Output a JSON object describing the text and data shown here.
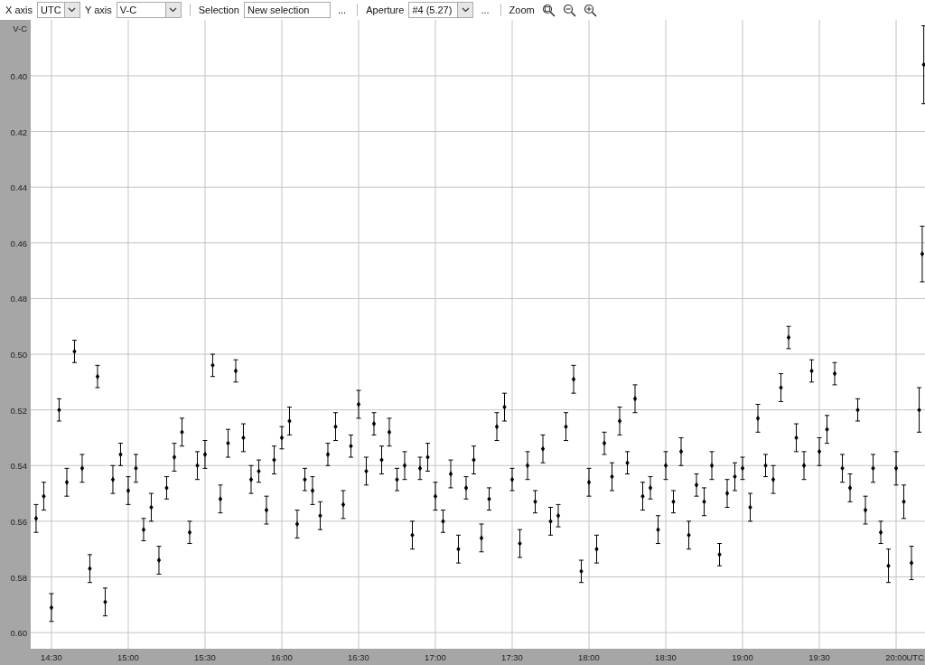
{
  "toolbar": {
    "x_axis": {
      "label": "X axis",
      "value": "UTC"
    },
    "y_axis": {
      "label": "Y axis",
      "value": "V-C"
    },
    "selection": {
      "label": "Selection",
      "value": "New selection",
      "more": "..."
    },
    "aperture": {
      "label": "Aperture",
      "value": "#4 (5.27)",
      "more": "..."
    },
    "zoom": {
      "label": "Zoom"
    }
  },
  "chart": {
    "chart_data": {
      "type": "scatter",
      "xlabel": "UTC",
      "ylabel": "V-C",
      "xlim": [
        14.365,
        20.188
      ],
      "ylim": [
        0.6058,
        0.3799
      ],
      "grid": true,
      "xticks": [
        {
          "value": 14.5,
          "label": "14:30"
        },
        {
          "value": 15,
          "label": "15:00"
        },
        {
          "value": 15.5,
          "label": "15:30"
        },
        {
          "value": 16,
          "label": "16:00"
        },
        {
          "value": 16.5,
          "label": "16:30"
        },
        {
          "value": 17,
          "label": "17:00"
        },
        {
          "value": 17.5,
          "label": "17:30"
        },
        {
          "value": 18,
          "label": "18:00"
        },
        {
          "value": 18.5,
          "label": "18:30"
        },
        {
          "value": 19,
          "label": "19:00"
        },
        {
          "value": 19.5,
          "label": "19:30"
        },
        {
          "value": 20,
          "label": "20:00"
        }
      ],
      "yticks": [
        {
          "value": 0.4,
          "label": "0.40"
        },
        {
          "value": 0.42,
          "label": "0.42"
        },
        {
          "value": 0.44,
          "label": "0.44"
        },
        {
          "value": 0.46,
          "label": "0.46"
        },
        {
          "value": 0.48,
          "label": "0.48"
        },
        {
          "value": 0.5,
          "label": "0.50"
        },
        {
          "value": 0.52,
          "label": "0.52"
        },
        {
          "value": 0.54,
          "label": "0.54"
        },
        {
          "value": 0.56,
          "label": "0.56"
        },
        {
          "value": 0.58,
          "label": "0.58"
        },
        {
          "value": 0.6,
          "label": "0.60"
        }
      ],
      "x": [
        14.4,
        14.45,
        14.5,
        14.55,
        14.6,
        14.65,
        14.7,
        14.75,
        14.8,
        14.85,
        14.9,
        14.95,
        15.0,
        15.05,
        15.1,
        15.15,
        15.2,
        15.25,
        15.3,
        15.35,
        15.4,
        15.45,
        15.5,
        15.55,
        15.6,
        15.65,
        15.7,
        15.75,
        15.8,
        15.85,
        15.9,
        15.95,
        16.0,
        16.05,
        16.1,
        16.15,
        16.2,
        16.25,
        16.3,
        16.35,
        16.4,
        16.45,
        16.5,
        16.55,
        16.6,
        16.65,
        16.7,
        16.75,
        16.8,
        16.85,
        16.9,
        16.95,
        17.0,
        17.05,
        17.1,
        17.15,
        17.2,
        17.25,
        17.3,
        17.35,
        17.4,
        17.45,
        17.5,
        17.55,
        17.6,
        17.65,
        17.7,
        17.75,
        17.8,
        17.85,
        17.9,
        17.95,
        18.0,
        18.05,
        18.1,
        18.15,
        18.2,
        18.25,
        18.3,
        18.35,
        18.4,
        18.45,
        18.5,
        18.55,
        18.6,
        18.65,
        18.7,
        18.75,
        18.8,
        18.85,
        18.9,
        18.95,
        19.0,
        19.05,
        19.1,
        19.15,
        19.2,
        19.25,
        19.3,
        19.35,
        19.4,
        19.45,
        19.5,
        19.55,
        19.6,
        19.65,
        19.7,
        19.75,
        19.8,
        19.85,
        19.9,
        19.95,
        20.0,
        20.05,
        20.1,
        20.15,
        20.17,
        20.18
      ],
      "series": [
        {
          "color": "#000000",
          "values": [
            0.559,
            0.551,
            0.591,
            0.52,
            0.546,
            0.499,
            0.541,
            0.577,
            0.508,
            0.589,
            0.545,
            0.536,
            0.549,
            0.541,
            0.563,
            0.555,
            0.574,
            0.548,
            0.537,
            0.528,
            0.564,
            0.54,
            0.536,
            0.504,
            0.552,
            0.532,
            0.506,
            0.53,
            0.545,
            0.542,
            0.556,
            0.538,
            0.53,
            0.524,
            0.561,
            0.545,
            0.549,
            0.558,
            0.536,
            0.526,
            0.554,
            0.533,
            0.518,
            0.542,
            0.525,
            0.538,
            0.528,
            0.545,
            0.54,
            0.565,
            0.541,
            0.537,
            0.551,
            0.56,
            0.543,
            0.57,
            0.548,
            0.538,
            0.566,
            0.552,
            0.526,
            0.519,
            0.545,
            0.568,
            0.54,
            0.553,
            0.534,
            0.56,
            0.558,
            0.526,
            0.509,
            0.578,
            0.546,
            0.57,
            0.532,
            0.544,
            0.524,
            0.539,
            0.516,
            0.551,
            0.548,
            0.563,
            0.54,
            0.553,
            0.535,
            0.565,
            0.547,
            0.553,
            0.54,
            0.572,
            0.55,
            0.544,
            0.541,
            0.555,
            0.523,
            0.54,
            0.545,
            0.512,
            0.494,
            0.53,
            0.54,
            0.506,
            0.535,
            0.527,
            0.507,
            0.541,
            0.548,
            0.52,
            0.556,
            0.541,
            0.564,
            0.576,
            0.541,
            0.553,
            0.575,
            0.52,
            0.464,
            0.396
          ],
          "errors": [
            0.005,
            0.005,
            0.005,
            0.004,
            0.005,
            0.004,
            0.005,
            0.005,
            0.004,
            0.005,
            0.005,
            0.004,
            0.005,
            0.005,
            0.004,
            0.005,
            0.005,
            0.004,
            0.005,
            0.005,
            0.004,
            0.005,
            0.005,
            0.004,
            0.005,
            0.005,
            0.004,
            0.005,
            0.005,
            0.004,
            0.005,
            0.005,
            0.004,
            0.005,
            0.005,
            0.004,
            0.005,
            0.005,
            0.004,
            0.005,
            0.005,
            0.004,
            0.005,
            0.005,
            0.004,
            0.005,
            0.005,
            0.004,
            0.005,
            0.005,
            0.004,
            0.005,
            0.005,
            0.004,
            0.005,
            0.005,
            0.004,
            0.005,
            0.005,
            0.004,
            0.005,
            0.005,
            0.004,
            0.005,
            0.005,
            0.004,
            0.005,
            0.005,
            0.004,
            0.005,
            0.005,
            0.004,
            0.005,
            0.005,
            0.004,
            0.005,
            0.005,
            0.004,
            0.005,
            0.005,
            0.004,
            0.005,
            0.005,
            0.004,
            0.005,
            0.005,
            0.004,
            0.005,
            0.005,
            0.004,
            0.005,
            0.005,
            0.004,
            0.005,
            0.005,
            0.004,
            0.005,
            0.005,
            0.004,
            0.005,
            0.005,
            0.004,
            0.005,
            0.005,
            0.004,
            0.005,
            0.005,
            0.004,
            0.005,
            0.005,
            0.004,
            0.006,
            0.006,
            0.006,
            0.006,
            0.008,
            0.01,
            0.014
          ]
        }
      ]
    }
  }
}
